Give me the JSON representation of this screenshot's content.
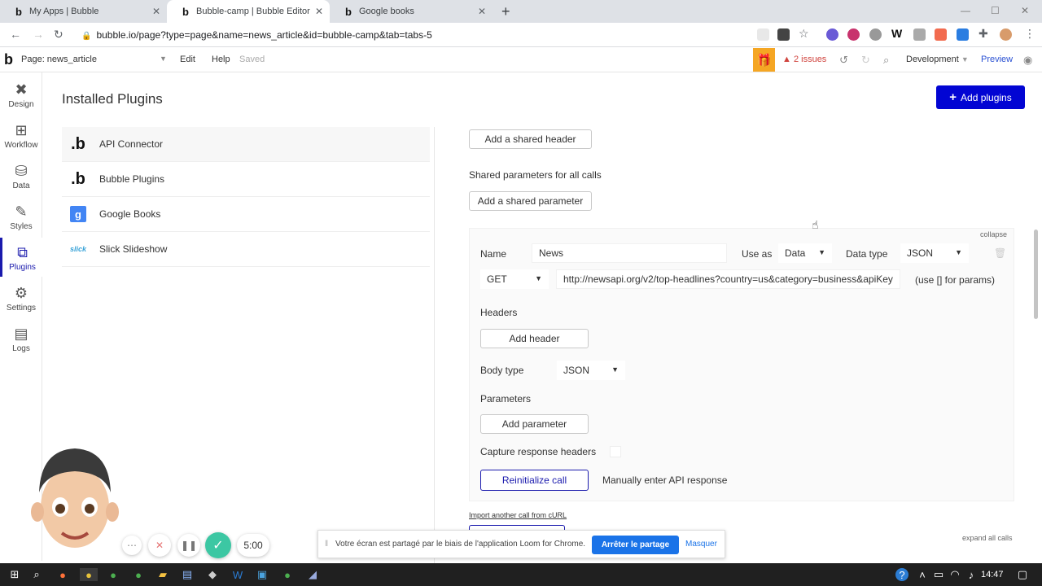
{
  "browser": {
    "tabs": [
      {
        "title": "My Apps | Bubble",
        "icon": "bubble-logo"
      },
      {
        "title": "Bubble-camp | Bubble Editor",
        "icon": "bubble-logo"
      },
      {
        "title": "Google books",
        "icon": "bubble-logo"
      }
    ],
    "url": "bubble.io/page?type=page&name=news_article&id=bubble-camp&tab=tabs-5"
  },
  "bubble": {
    "logo": "b",
    "page_label": "Page: news_article",
    "menu": {
      "edit": "Edit",
      "help": "Help",
      "saved": "Saved"
    },
    "issues": "2 issues",
    "environment": "Development",
    "preview": "Preview"
  },
  "sidebar": {
    "items": [
      {
        "label": "Design",
        "icon": "design-icon"
      },
      {
        "label": "Workflow",
        "icon": "workflow-icon"
      },
      {
        "label": "Data",
        "icon": "data-icon"
      },
      {
        "label": "Styles",
        "icon": "styles-icon"
      },
      {
        "label": "Plugins",
        "icon": "plugins-icon"
      },
      {
        "label": "Settings",
        "icon": "settings-icon"
      },
      {
        "label": "Logs",
        "icon": "logs-icon"
      }
    ]
  },
  "main": {
    "title": "Installed Plugins",
    "add_plugins": "Add plugins",
    "plugins": [
      {
        "name": "API Connector",
        "icon": "b"
      },
      {
        "name": "Bubble Plugins",
        "icon": "b"
      },
      {
        "name": "Google Books",
        "icon": "g"
      },
      {
        "name": "Slick Slideshow",
        "icon": "slick"
      }
    ]
  },
  "api": {
    "add_shared_header": "Add a shared header",
    "shared_params_label": "Shared parameters for all calls",
    "add_shared_param": "Add a shared parameter",
    "collapse": "collapse",
    "name_label": "Name",
    "name_value": "News",
    "use_as_label": "Use as",
    "use_as_value": "Data",
    "data_type_label": "Data type",
    "data_type_value": "JSON",
    "method": "GET",
    "endpoint": "http://newsapi.org/v2/top-headlines?country=us&category=business&apiKey",
    "params_hint": "(use [] for params)",
    "headers_label": "Headers",
    "add_header": "Add header",
    "body_type_label": "Body type",
    "body_type_value": "JSON",
    "parameters_label": "Parameters",
    "add_parameter": "Add parameter",
    "capture_label": "Capture response headers",
    "reinitialize": "Reinitialize call",
    "manual_response": "Manually enter API response",
    "import_curl": "Import another call from cURL",
    "expand_all": "expand all calls"
  },
  "share": {
    "message": "Votre écran est partagé par le biais de l'application Loom for Chrome.",
    "stop": "Arrêter le partage",
    "hide": "Masquer"
  },
  "loom": {
    "timer": "5:00"
  },
  "taskbar": {
    "time": "14:47"
  }
}
